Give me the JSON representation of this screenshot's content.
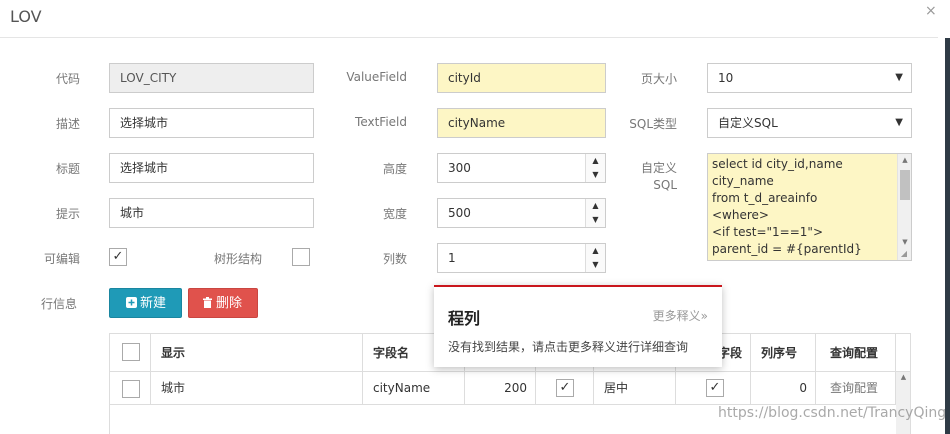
{
  "dialog": {
    "title": "LOV",
    "close_glyph": "×"
  },
  "form": {
    "code": {
      "label": "代码",
      "value": "LOV_CITY"
    },
    "desc": {
      "label": "描述",
      "value": "选择城市"
    },
    "title": {
      "label": "标题",
      "value": "选择城市"
    },
    "hint": {
      "label": "提示",
      "value": "城市"
    },
    "editable": {
      "label": "可编辑",
      "checked": true
    },
    "tree": {
      "label": "树形结构",
      "checked": false
    },
    "value_field": {
      "label": "ValueField",
      "value": "cityId"
    },
    "text_field": {
      "label": "TextField",
      "value": "cityName"
    },
    "height": {
      "label": "高度",
      "value": "300"
    },
    "width": {
      "label": "宽度",
      "value": "500"
    },
    "columns": {
      "label": "列数",
      "value": "1"
    },
    "page_size": {
      "label": "页大小",
      "value": "10"
    },
    "sql_type": {
      "label": "SQL类型",
      "value": "自定义SQL"
    },
    "custom_sql": {
      "label_line1": "自定义",
      "label_line2": "SQL",
      "lines": [
        "select id city_id,name",
        "city_name",
        "from t_d_areainfo",
        "<where>",
        "<if test=\"1==1\">",
        "parent_id = #{parentId}"
      ]
    },
    "row_info_label": "行信息"
  },
  "buttons": {
    "new_label": "新建",
    "delete_label": "删除"
  },
  "table": {
    "headers": [
      "显示",
      "字段名",
      "",
      "",
      "",
      "字段",
      "列序号",
      "查询配置"
    ],
    "rows": [
      {
        "display": "城市",
        "field": "cityName",
        "width": "200",
        "checked1": true,
        "align": "居中",
        "checked2": true,
        "order": "0",
        "config": "查询配置"
      }
    ]
  },
  "popup": {
    "title": "程列",
    "more": "更多释义»",
    "message": "没有找到结果，请点击更多释义进行详细查询"
  },
  "watermark": "https://blog.csdn.net/TrancyQing",
  "colors": {
    "input_highlight": "#fdf6c5",
    "btn_new": "#1f9ab7",
    "btn_delete": "#e0524c",
    "popup_accent": "#c9161c"
  }
}
